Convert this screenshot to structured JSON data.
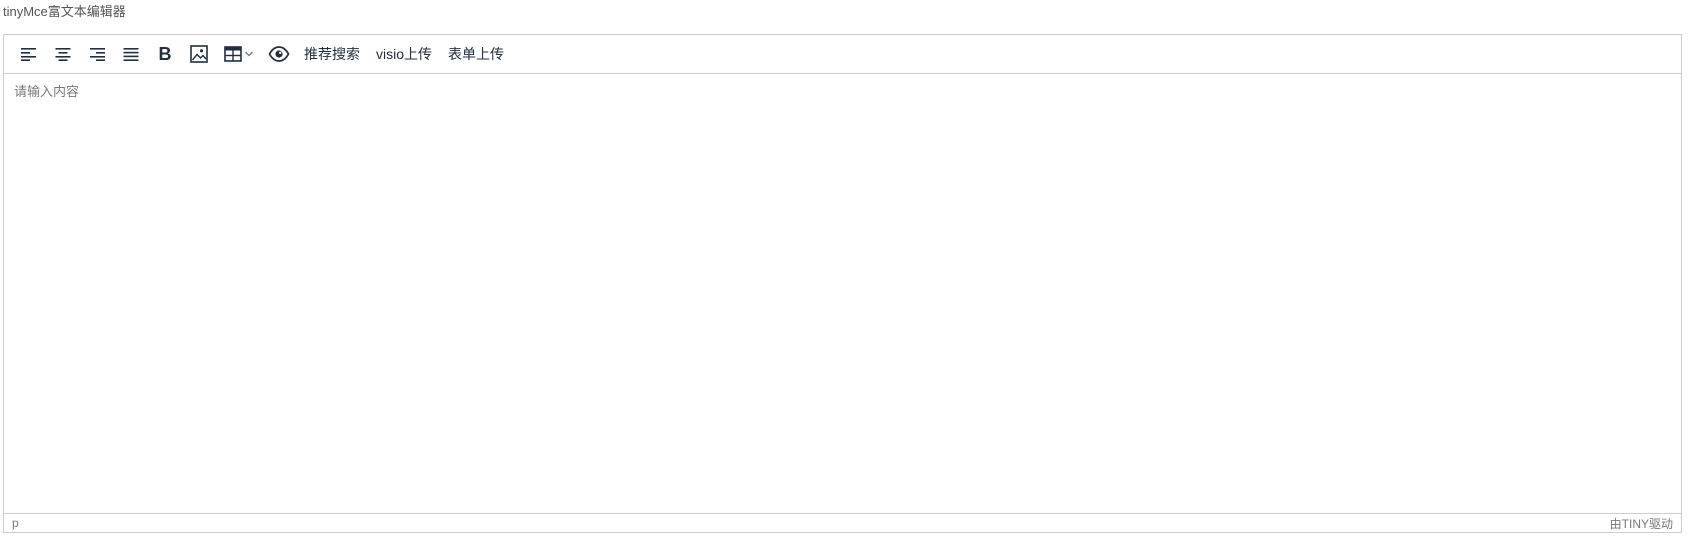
{
  "page": {
    "title": "tinyMce富文本编辑器"
  },
  "toolbar": {
    "items": [
      {
        "icon": "align-left-icon"
      },
      {
        "icon": "align-center-icon"
      },
      {
        "icon": "align-right-icon"
      },
      {
        "icon": "align-justify-icon"
      },
      {
        "icon": "bold-icon",
        "glyph": "B"
      },
      {
        "icon": "image-icon"
      },
      {
        "icon": "table-icon"
      },
      {
        "icon": "preview-icon"
      }
    ],
    "custom_buttons": {
      "recommend_search": "推荐搜索",
      "visio_upload": "visio上传",
      "form_upload": "表单上传"
    }
  },
  "editor": {
    "placeholder": "请输入内容"
  },
  "statusbar": {
    "path": "p",
    "branding": "由TINY驱动"
  },
  "colors": {
    "icon": "#222f3e",
    "border": "#cccccc",
    "muted_text": "#777777"
  }
}
